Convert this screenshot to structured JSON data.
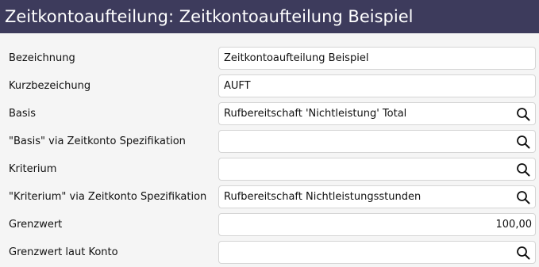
{
  "header": {
    "title": "Zeitkontoaufteilung: Zeitkontoaufteilung Beispiel"
  },
  "form": {
    "fields": [
      {
        "label": "Bezeichnung",
        "value": "Zeitkontoaufteilung Beispiel",
        "has_search": false
      },
      {
        "label": "Kurzbezeichung",
        "value": "AUFT",
        "has_search": false
      },
      {
        "label": "Basis",
        "value": "Rufbereitschaft 'Nichtleistung' Total",
        "has_search": true
      },
      {
        "label": "\"Basis\" via Zeitkonto Spezifikation",
        "value": "",
        "has_search": true
      },
      {
        "label": "Kriterium",
        "value": "",
        "has_search": true
      },
      {
        "label": "\"Kriterium\" via Zeitkonto Spezifikation",
        "value": "Rufbereitschaft Nichtleistungsstunden",
        "has_search": true
      },
      {
        "label": "Grenzwert",
        "value": "100,00",
        "has_search": false
      },
      {
        "label": "Grenzwert laut Konto",
        "value": "",
        "has_search": true
      }
    ]
  }
}
